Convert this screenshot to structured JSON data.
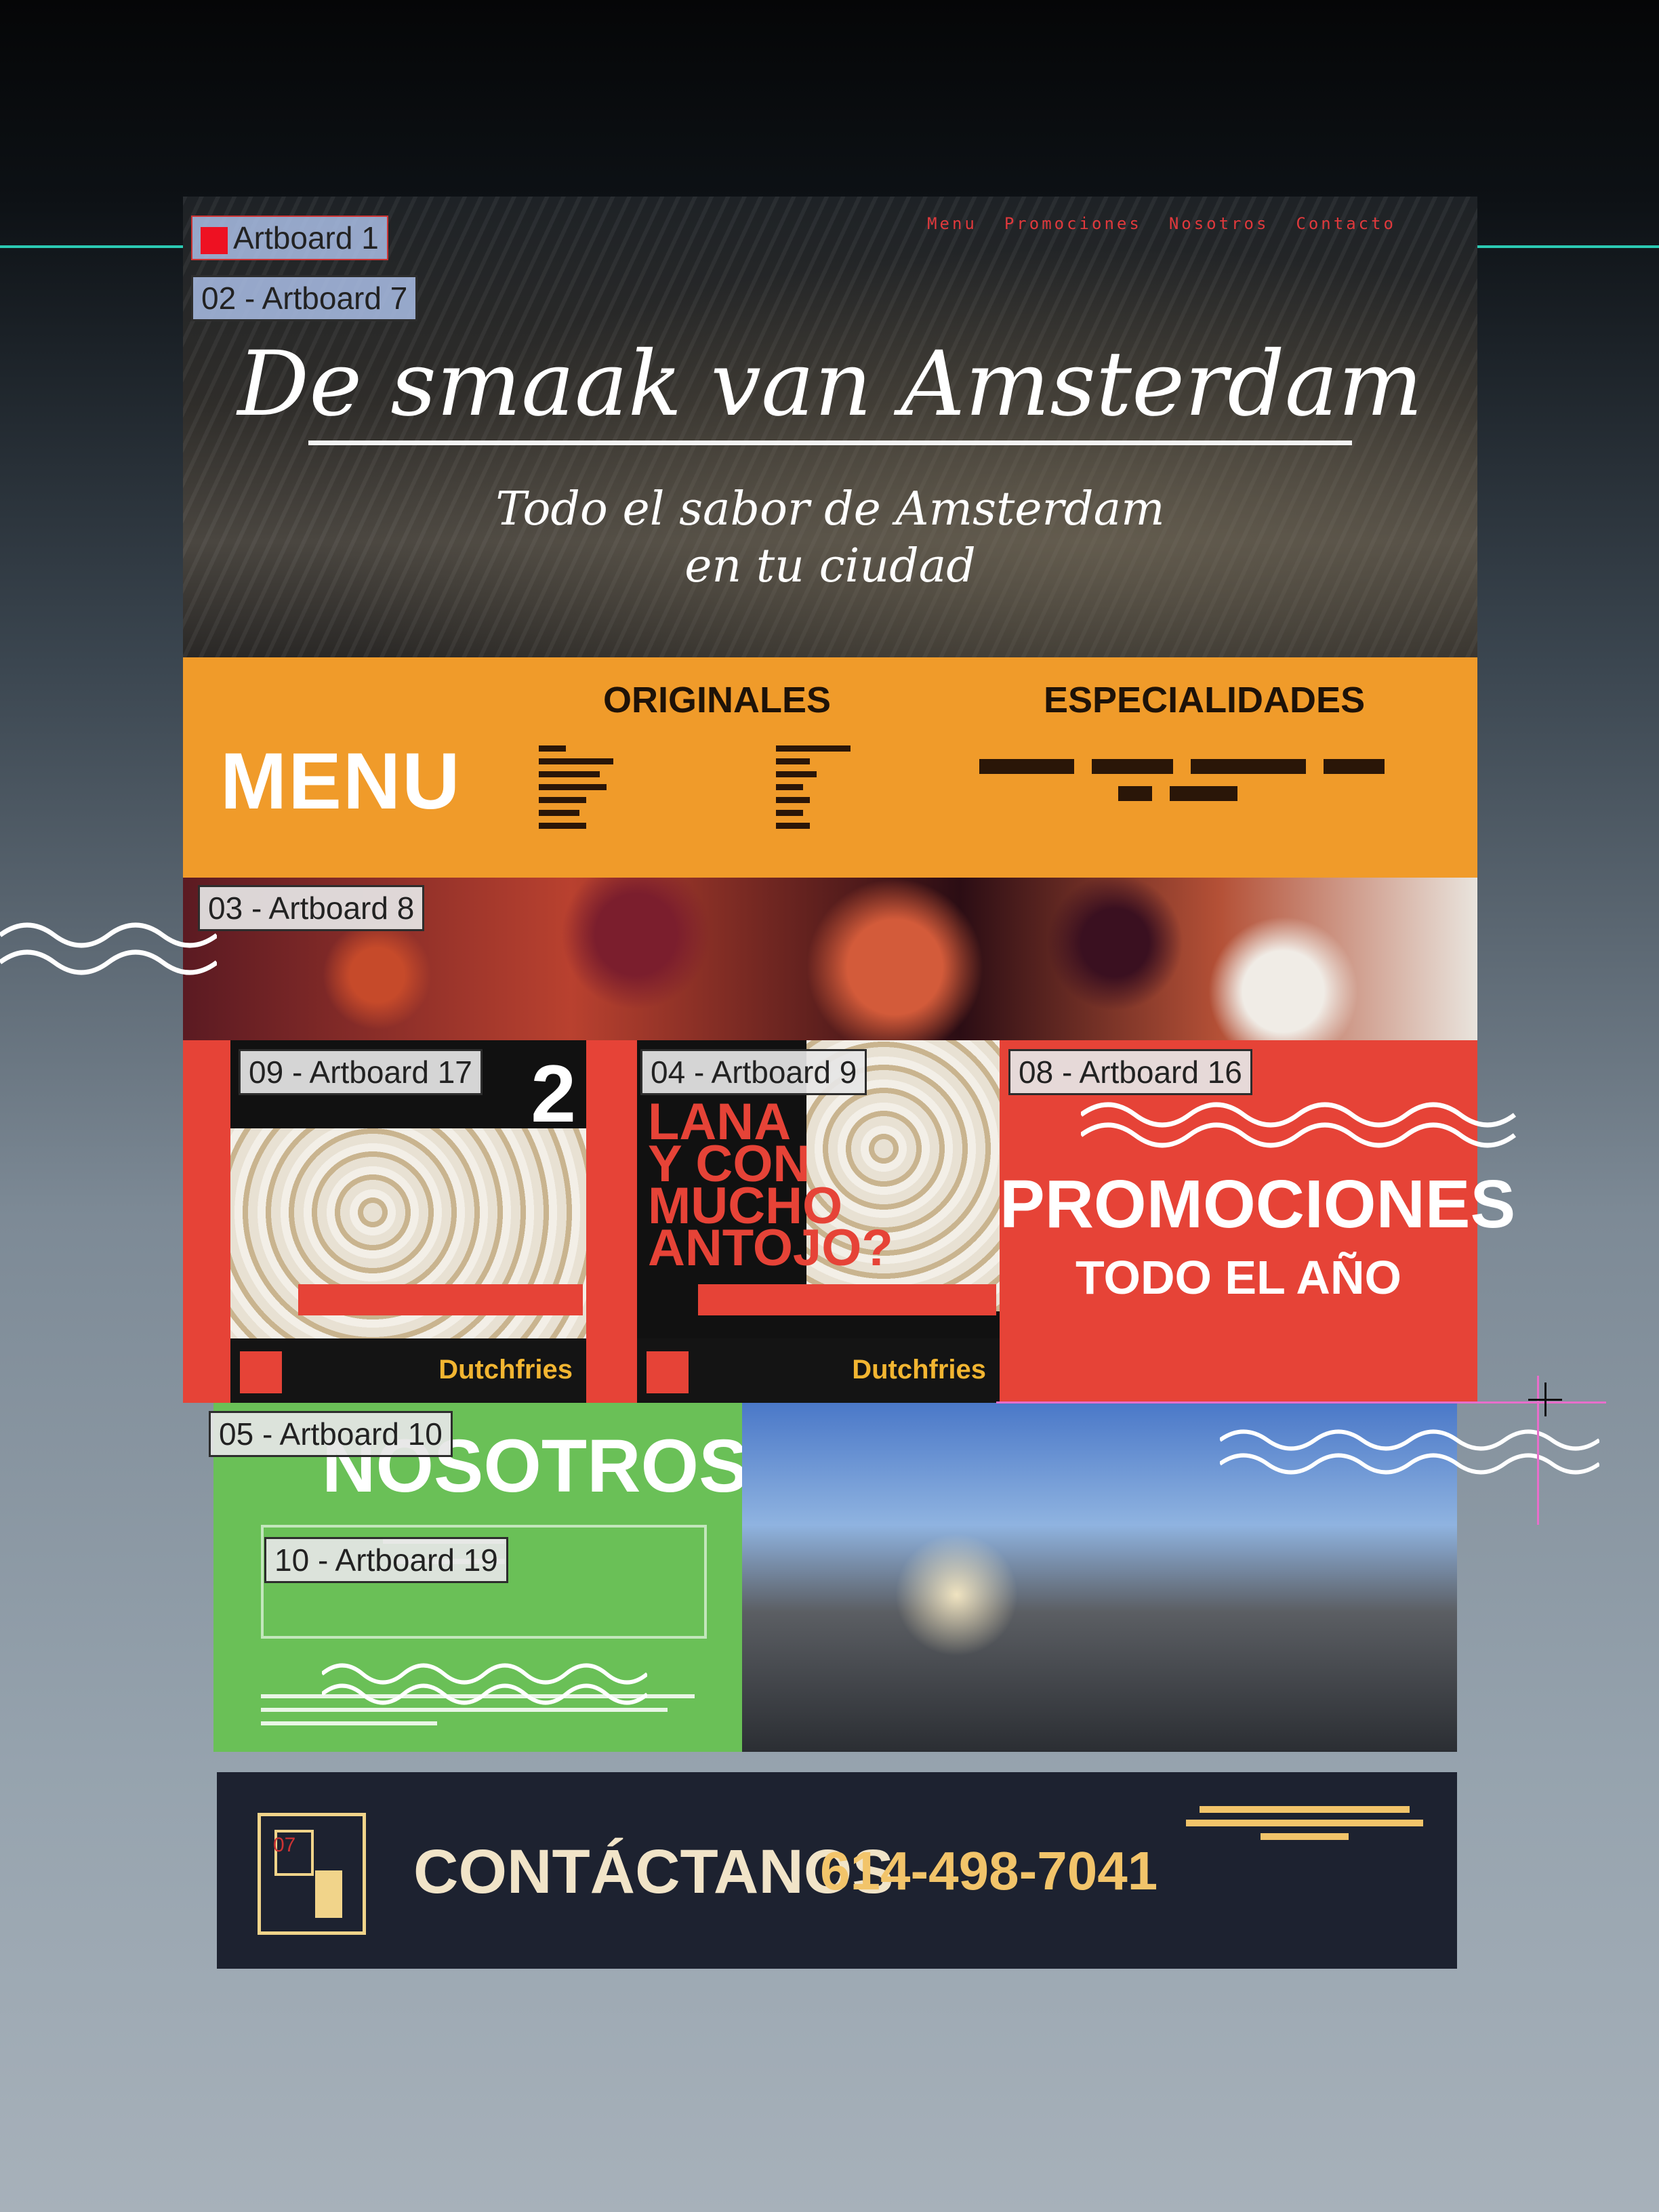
{
  "nav": [
    "Menu",
    "Promociones",
    "Nosotros",
    "Contacto"
  ],
  "hero": {
    "title": "De smaak van Amsterdam",
    "subtitle_line1": "Todo el sabor de Amsterdam",
    "subtitle_line2": "en tu ciudad"
  },
  "menu": {
    "label": "MENU",
    "col1_title": "ORIGINALES",
    "col2_title": "ESPECIALIDADES"
  },
  "promos": {
    "card1_number": "2",
    "card2_text": "LANA Y CON MUCHO ANTOJO?",
    "card_brand": "Dutchfries",
    "title": "PROMOCIONES",
    "subtitle": "TODO EL AÑO"
  },
  "about": {
    "title": "NOSOTROS"
  },
  "contact": {
    "title": "CONTÁCTANOS",
    "phone": "614-498-7041",
    "icon_label": "07"
  },
  "artboards": {
    "a1": "Artboard 1",
    "a7": "02 - Artboard 7",
    "a8": "03 - Artboard 8",
    "a17": "09 - Artboard 17",
    "a9": "04 - Artboard 9",
    "a16": "08 - Artboard 16",
    "a10": "05 - Artboard 10",
    "a19": "10 - Artboard 19"
  },
  "colors": {
    "accent_orange": "#f09b2a",
    "accent_red": "#e64337",
    "accent_green": "#6ac057",
    "contact_bg": "#1d2230",
    "guide_teal": "#2bc9b2"
  }
}
